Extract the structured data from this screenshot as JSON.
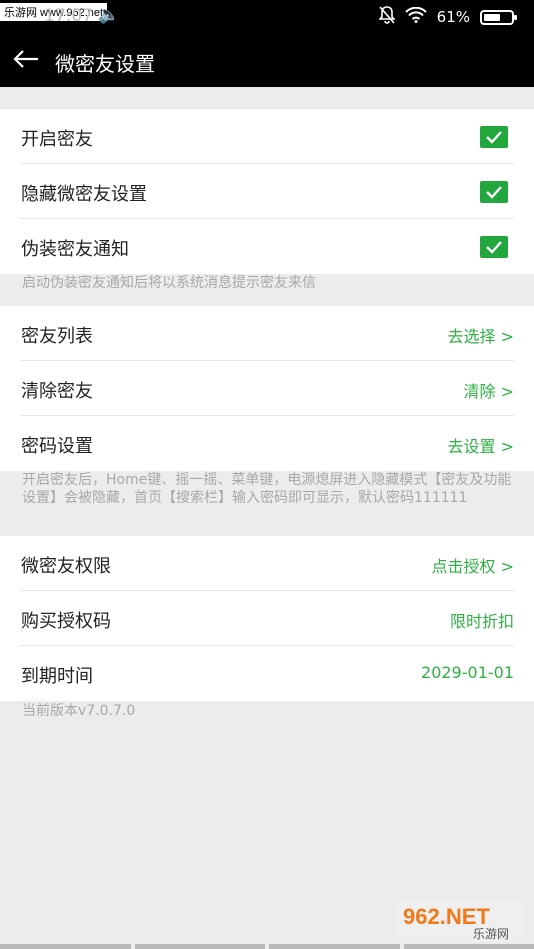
{
  "watermark_top": "乐游网 www.962.net",
  "status_bar": {
    "time": "17:07",
    "battery_text": "61%",
    "battery_level": 0.61
  },
  "header": {
    "title": "微密友设置"
  },
  "section1": {
    "items": [
      {
        "label": "开启密友",
        "checked": true
      },
      {
        "label": "隐藏微密友设置",
        "checked": true
      },
      {
        "label": "伪装密友通知",
        "checked": true
      }
    ]
  },
  "note1": "启动伪装密友通知后将以系统消息提示密友来信",
  "section2": {
    "items": [
      {
        "label": "密友列表",
        "action": "去选择 >"
      },
      {
        "label": "清除密友",
        "action": "清除 >"
      },
      {
        "label": "密码设置",
        "action": "去设置 >"
      }
    ]
  },
  "note2": "开启密友后，Home键、摇一摇、菜单键，电源熄屏进入隐藏模式【密友及功能设置】会被隐藏，首页【搜索栏】输入密码即可显示，默认密码111111",
  "section3": {
    "items": [
      {
        "label": "微密友权限",
        "action": "点击授权 >"
      },
      {
        "label": "购买授权码",
        "action": "限时折扣"
      },
      {
        "label": "到期时间",
        "action": "2029-01-01"
      }
    ]
  },
  "version": "当前版本v7.0.7.0",
  "watermark_bottom": {
    "logo": "962.NET",
    "sub": "乐游网"
  },
  "colors": {
    "accent": "#2eb043",
    "check_bg": "#22a73d",
    "header_bg": "#000000",
    "page_bg": "#ececec"
  }
}
